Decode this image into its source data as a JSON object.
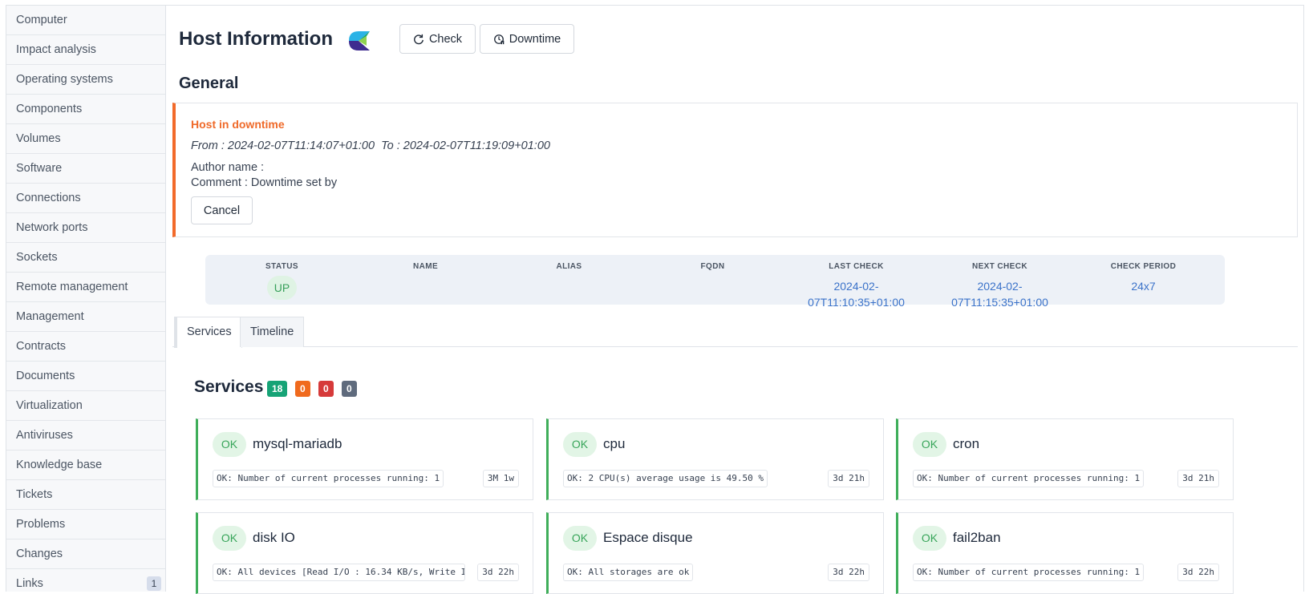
{
  "sidebar": {
    "items": [
      {
        "label": "Computer"
      },
      {
        "label": "Impact analysis"
      },
      {
        "label": "Operating systems"
      },
      {
        "label": "Components"
      },
      {
        "label": "Volumes"
      },
      {
        "label": "Software"
      },
      {
        "label": "Connections"
      },
      {
        "label": "Network ports"
      },
      {
        "label": "Sockets"
      },
      {
        "label": "Remote management"
      },
      {
        "label": "Management"
      },
      {
        "label": "Contracts"
      },
      {
        "label": "Documents"
      },
      {
        "label": "Virtualization"
      },
      {
        "label": "Antiviruses"
      },
      {
        "label": "Knowledge base"
      },
      {
        "label": "Tickets"
      },
      {
        "label": "Problems"
      },
      {
        "label": "Changes"
      },
      {
        "label": "Links",
        "badge": "1"
      }
    ]
  },
  "header": {
    "title": "Host Information",
    "check_label": "Check",
    "downtime_label": "Downtime"
  },
  "general": {
    "title": "General",
    "downtime": {
      "title": "Host in downtime",
      "range": "From : 2024-02-07T11:14:07+01:00  To : 2024-02-07T11:19:09+01:00",
      "author": "Author name :",
      "comment": "Comment : Downtime set by",
      "cancel_label": "Cancel"
    }
  },
  "host_table": {
    "headers": [
      "STATUS",
      "NAME",
      "ALIAS",
      "FQDN",
      "LAST CHECK",
      "NEXT CHECK",
      "CHECK PERIOD"
    ],
    "status": "UP",
    "name": "",
    "alias": "",
    "fqdn": "",
    "last_check_1": "2024-02-",
    "last_check_2": "07T11:10:35+01:00",
    "next_check_1": "2024-02-",
    "next_check_2": "07T11:15:35+01:00",
    "check_period": "24x7"
  },
  "tabs": [
    {
      "label": "Services"
    },
    {
      "label": "Timeline"
    }
  ],
  "services": {
    "title": "Services",
    "counts": [
      {
        "value": "18",
        "color": "#16a376"
      },
      {
        "value": "0",
        "color": "#f06a1d"
      },
      {
        "value": "0",
        "color": "#d63a3a"
      },
      {
        "value": "0",
        "color": "#5f6b7d"
      }
    ],
    "items": [
      {
        "status": "OK",
        "name": "mysql-mariadb",
        "output": "OK: Number of current processes running: 1",
        "age": "3M 1w"
      },
      {
        "status": "OK",
        "name": "cpu",
        "output": "OK: 2 CPU(s) average usage is 49.50 %",
        "age": "3d 21h"
      },
      {
        "status": "OK",
        "name": "cron",
        "output": "OK: Number of current processes running: 1",
        "age": "3d 21h"
      },
      {
        "status": "OK",
        "name": "disk IO",
        "output": "OK: All devices [Read I/O : 16.34 KB/s, Write I/O",
        "age": "3d 22h"
      },
      {
        "status": "OK",
        "name": "Espace disque",
        "output": "OK: All storages are ok",
        "age": "3d 22h"
      },
      {
        "status": "OK",
        "name": "fail2ban",
        "output": "OK: Number of current processes running: 1",
        "age": "3d 22h"
      }
    ]
  },
  "colors": {
    "downtime_accent": "#f26a2a",
    "ok_green": "#3fae5a",
    "link_blue": "#3a72c9"
  }
}
